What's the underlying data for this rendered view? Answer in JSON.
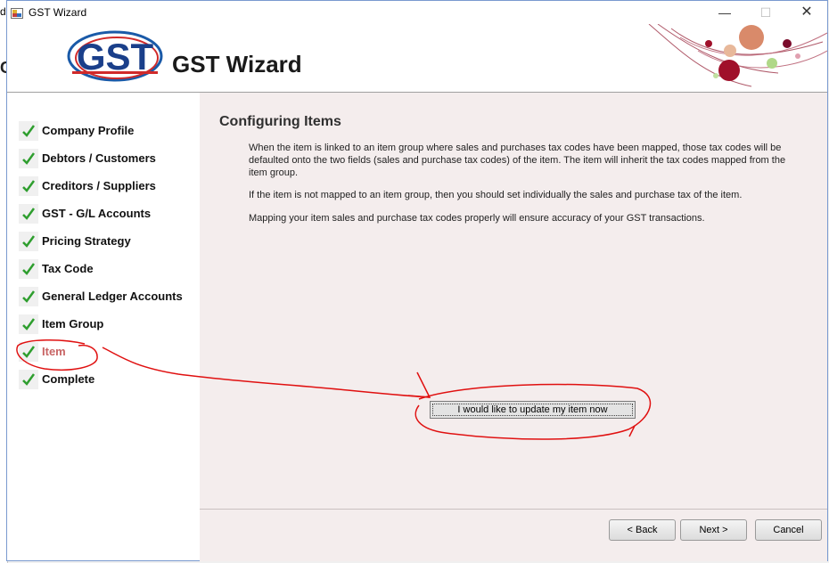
{
  "window": {
    "title": "GST Wizard"
  },
  "background_window": {
    "edge_char_top": "d",
    "edge_char_mid": "G"
  },
  "header": {
    "title": "GST Wizard",
    "logo_text": "GST"
  },
  "steps": [
    {
      "label": "Company Profile",
      "done": true
    },
    {
      "label": "Debtors / Customers",
      "done": true
    },
    {
      "label": "Creditors / Suppliers",
      "done": true
    },
    {
      "label": "GST - G/L Accounts",
      "done": true
    },
    {
      "label": "Pricing Strategy",
      "done": true
    },
    {
      "label": "Tax Code",
      "done": true
    },
    {
      "label": "General Ledger Accounts",
      "done": true
    },
    {
      "label": "Item Group",
      "done": true
    },
    {
      "label": "Item",
      "done": true,
      "active": true
    },
    {
      "label": "Complete",
      "done": true
    }
  ],
  "content": {
    "title": "Configuring Items",
    "paragraphs": [
      "When the item is linked to an item group where sales and purchases tax codes have been mapped, those tax codes will be defaulted onto the two fields (sales and purchase tax codes) of the item. The item will inherit the tax codes mapped from the item group.",
      "If the item is not mapped to an item group, then you should set individually the sales and purchase tax of the item.",
      "Mapping your item sales and purchase tax codes properly will ensure accuracy of your GST transactions."
    ],
    "action_button": "I would like to update my item now"
  },
  "footer": {
    "back": "< Back",
    "next": "Next >",
    "cancel": "Cancel"
  },
  "colors": {
    "active_step": "#c86464",
    "check": "#2e9e2e",
    "annotation": "#e01010",
    "content_bg": "#f4eded"
  }
}
